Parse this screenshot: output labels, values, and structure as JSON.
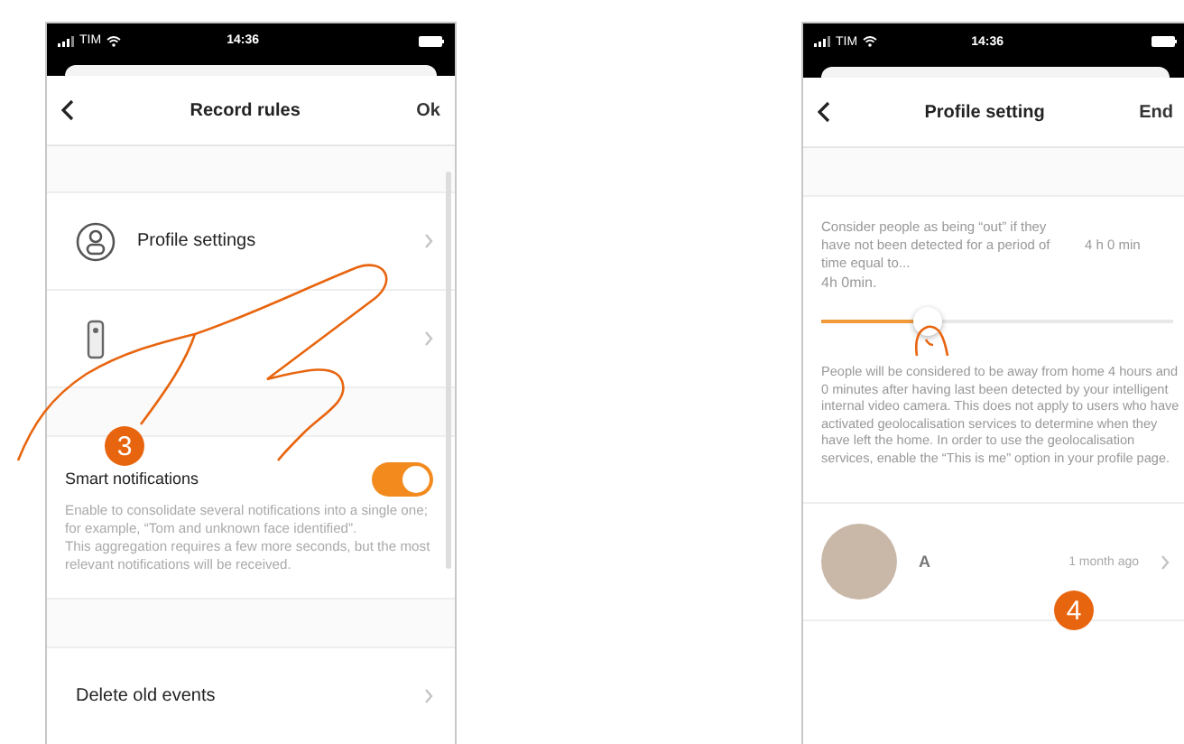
{
  "left_screen": {
    "status_bar": {
      "carrier": "TIM",
      "time": "14:36"
    },
    "header": {
      "title": "Record rules",
      "action": "Ok"
    },
    "sections": [
      {
        "items": [
          {
            "kind": "link",
            "label": "Profile settings"
          },
          {
            "kind": "link"
          }
        ]
      },
      {
        "items": [
          {
            "kind": "toggle",
            "label": "Smart notifications",
            "on": true,
            "description": [
              "Enable to consolidate several notifications into a single one; for example, “Tom and unknown face identified”.",
              "This aggregation requires a few more seconds, but the most relevant notifications will be received."
            ]
          }
        ]
      },
      {
        "items": [
          {
            "kind": "link",
            "label": "Delete old events"
          }
        ]
      }
    ],
    "step_badge": "3"
  },
  "right_screen": {
    "status_bar": {
      "carrier": "TIM",
      "time": "14:36"
    },
    "header": {
      "title": "Profile setting",
      "action": "End"
    },
    "absence": {
      "description": "Consider people as being “out” if they have not been detected for a period of time equal to...",
      "value": "4h 0min.",
      "reading": "4 h 0 min",
      "level": 0.3
    },
    "note": "People will be considered to be away from home 4 hours and 0 minutes after having last been detected by your intelligent internal video camera. This does not apply to users who have activated geolocalisation services to determine when they have left the home. In order to use the geolocalisation services, enable the “This is me” option in your profile page.",
    "user": {
      "name": "A",
      "time": "1 month ago"
    },
    "step_badge": "4"
  }
}
